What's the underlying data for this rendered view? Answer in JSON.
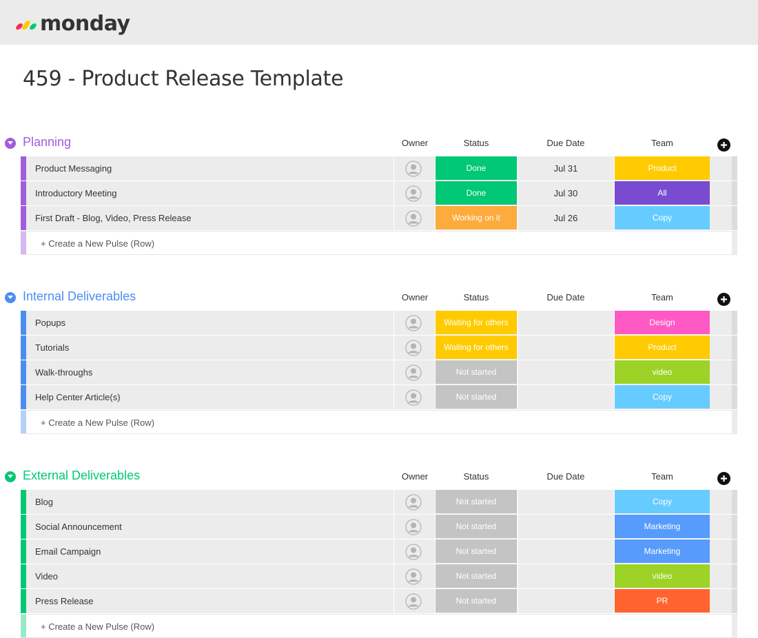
{
  "app": {
    "logo_text": "monday"
  },
  "page_title": "459 - Product Release Template",
  "colors": {
    "planning": "#a25ddc",
    "internal": "#4b8ef1",
    "external": "#00c875",
    "done": "#00c875",
    "working": "#fdab3d",
    "waiting": "#ffcb00",
    "not_started": "#c4c4c4",
    "product": "#ffcb00",
    "all": "#784bd1",
    "copy": "#66ccff",
    "design": "#ff5ac4",
    "video": "#9cd326",
    "marketing": "#579bfc",
    "pr": "#ff642e"
  },
  "columns": {
    "owner": "Owner",
    "status": "Status",
    "due_date": "Due Date",
    "team": "Team"
  },
  "groups": [
    {
      "title": "Planning",
      "create_label": "+ Create a New Pulse (Row)",
      "rows": [
        {
          "name": "Product Messaging",
          "status": "Done",
          "due": "Jul 31",
          "team": "Product"
        },
        {
          "name": "Introductory Meeting",
          "status": "Done",
          "due": "Jul 30",
          "team": "All"
        },
        {
          "name": "First Draft - Blog, Video, Press Release",
          "status": "Working on it",
          "due": "Jul 26",
          "team": "Copy"
        }
      ]
    },
    {
      "title": "Internal Deliverables",
      "create_label": "+ Create a New Pulse (Row)",
      "rows": [
        {
          "name": "Popups",
          "status": "Waiting for others",
          "due": "",
          "team": "Design"
        },
        {
          "name": "Tutorials",
          "status": "Waiting for others",
          "due": "",
          "team": "Product"
        },
        {
          "name": "Walk-throughs",
          "status": "Not started",
          "due": "",
          "team": "video"
        },
        {
          "name": "Help Center Article(s)",
          "status": "Not started",
          "due": "",
          "team": "Copy"
        }
      ]
    },
    {
      "title": "External Deliverables",
      "create_label": "+ Create a New Pulse (Row)",
      "rows": [
        {
          "name": "Blog",
          "status": "Not started",
          "due": "",
          "team": "Copy"
        },
        {
          "name": "Social Announcement",
          "status": "Not started",
          "due": "",
          "team": "Marketing"
        },
        {
          "name": "Email Campaign",
          "status": "Not started",
          "due": "",
          "team": "Marketing"
        },
        {
          "name": "Video",
          "status": "Not started",
          "due": "",
          "team": "video"
        },
        {
          "name": "Press Release",
          "status": "Not started",
          "due": "",
          "team": "PR"
        }
      ]
    }
  ]
}
